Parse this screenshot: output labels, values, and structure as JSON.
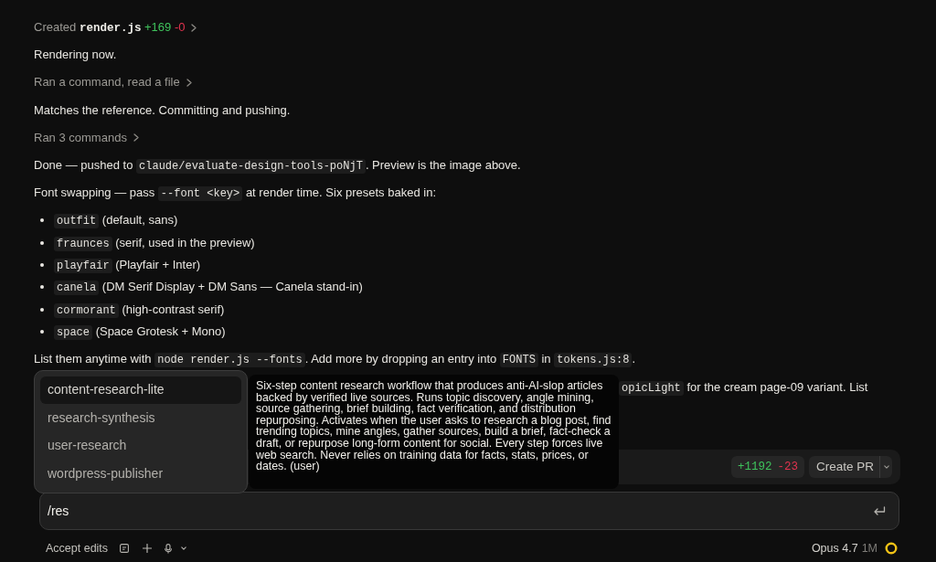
{
  "conversation": [
    {
      "kind": "activity",
      "segments": [
        {
          "kind": "text",
          "text": "Created "
        },
        {
          "kind": "file",
          "text": "render.js"
        },
        {
          "kind": "added",
          "text": " +169"
        },
        {
          "kind": "removed",
          "text": " -0"
        }
      ]
    },
    {
      "kind": "paragraph",
      "segments": [
        {
          "kind": "text",
          "text": "Rendering now."
        }
      ]
    },
    {
      "kind": "activity",
      "segments": [
        {
          "kind": "text",
          "text": "Ran a command, read a file"
        }
      ]
    },
    {
      "kind": "paragraph",
      "segments": [
        {
          "kind": "text",
          "text": "Matches the reference. Committing and pushing."
        }
      ]
    },
    {
      "kind": "activity",
      "segments": [
        {
          "kind": "text",
          "text": "Ran 3 commands"
        }
      ]
    },
    {
      "kind": "paragraph",
      "segments": [
        {
          "kind": "text",
          "text": "Done — pushed to "
        },
        {
          "kind": "code",
          "text": "claude/evaluate-design-tools-poNjT"
        },
        {
          "kind": "text",
          "text": ". Preview is the image above."
        }
      ]
    },
    {
      "kind": "paragraph",
      "segments": [
        {
          "kind": "text",
          "text": "Font swapping — pass "
        },
        {
          "kind": "code",
          "text": "--font <key>"
        },
        {
          "kind": "text",
          "text": " at render time. Six presets baked in:"
        }
      ]
    },
    {
      "kind": "bullets",
      "items": [
        {
          "segments": [
            {
              "kind": "code",
              "text": "outfit"
            },
            {
              "kind": "text",
              "text": " (default, sans)"
            }
          ]
        },
        {
          "segments": [
            {
              "kind": "code",
              "text": "fraunces"
            },
            {
              "kind": "text",
              "text": " (serif, used in the preview)"
            }
          ]
        },
        {
          "segments": [
            {
              "kind": "code",
              "text": "playfair"
            },
            {
              "kind": "text",
              "text": " (Playfair + Inter)"
            }
          ]
        },
        {
          "segments": [
            {
              "kind": "code",
              "text": "canela"
            },
            {
              "kind": "text",
              "text": " (DM Serif Display + DM Sans — Canela stand-in)"
            }
          ]
        },
        {
          "segments": [
            {
              "kind": "code",
              "text": "cormorant"
            },
            {
              "kind": "text",
              "text": " (high-contrast serif)"
            }
          ]
        },
        {
          "segments": [
            {
              "kind": "code",
              "text": "space"
            },
            {
              "kind": "text",
              "text": " (Space Grotesk + Mono)"
            }
          ]
        }
      ]
    },
    {
      "kind": "paragraph",
      "segments": [
        {
          "kind": "text",
          "text": "List them anytime with "
        },
        {
          "kind": "code",
          "text": "node render.js --fonts"
        },
        {
          "kind": "text",
          "text": ". Add more by dropping an entry into "
        },
        {
          "kind": "code",
          "text": "FONTS"
        },
        {
          "kind": "text",
          "text": " in "
        },
        {
          "kind": "code",
          "text": "tokens.js:8"
        },
        {
          "kind": "text",
          "text": "."
        }
      ]
    },
    {
      "kind": "covered_paragraph",
      "segments": [
        {
          "kind": "code",
          "text": "opicLight"
        },
        {
          "kind": "text",
          "text": " for the cream page-09 variant. List"
        }
      ]
    }
  ],
  "changes_bar": {
    "added": "+1192",
    "removed": "-23",
    "create_pr": "Create PR"
  },
  "autocomplete": {
    "items": [
      {
        "label": "content-research-lite",
        "selected": true
      },
      {
        "label": "research-synthesis",
        "selected": false
      },
      {
        "label": "user-research",
        "selected": false
      },
      {
        "label": "wordpress-publisher",
        "selected": false
      }
    ],
    "description": "Six-step content research workflow that produces anti-AI-slop articles backed by verified live sources. Runs topic discovery, angle mining, source gathering, brief building, fact verification, and distribution repurposing. Activates when the user asks to research a blog post, find trending topics, mine angles, gather sources, build a brief, fact-check a draft, or repurpose long-form content for social. Every step forces live web search. Never relies on training data for facts, stats, prices, or dates. (user)"
  },
  "composer": {
    "value": "/res"
  },
  "footer": {
    "mode": "Accept edits",
    "model": "Opus 4.7",
    "context": "1M"
  }
}
